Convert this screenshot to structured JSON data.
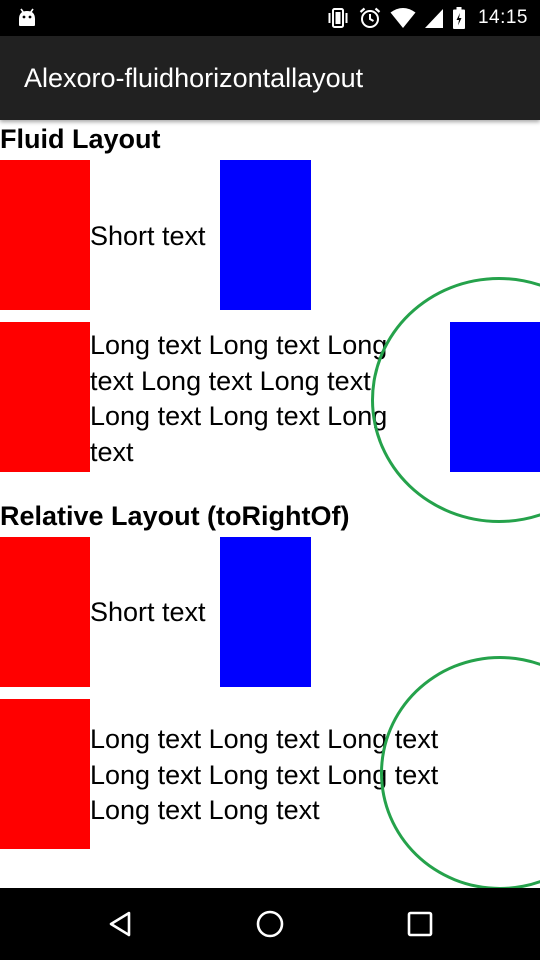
{
  "status_bar": {
    "time": "14:15",
    "icons": [
      "android-debug-icon",
      "vibrate-icon",
      "alarm-icon",
      "wifi-icon",
      "signal-icon",
      "battery-icon"
    ]
  },
  "app_bar": {
    "title": "Alexoro-fluidhorizontallayout"
  },
  "fluid_section": {
    "title": "Fluid Layout",
    "row1_text": "Short text",
    "row2_lines": [
      "Long text Long text Long",
      "text Long text Long text",
      "Long text Long text Long",
      "text"
    ]
  },
  "relative_section": {
    "title": "Relative Layout (toRightOf)",
    "row1_text": "Short text",
    "row2_lines": [
      "Long text Long text Long text",
      "Long text Long text Long text",
      "Long text Long text"
    ]
  },
  "nav_bar": {
    "icons": [
      "back-icon",
      "home-icon",
      "recents-icon"
    ]
  },
  "colors": {
    "red_box": "#ff0000",
    "blue_box": "#0000ff",
    "annotation_circle": "#25a24b",
    "app_bar": "#212121"
  }
}
